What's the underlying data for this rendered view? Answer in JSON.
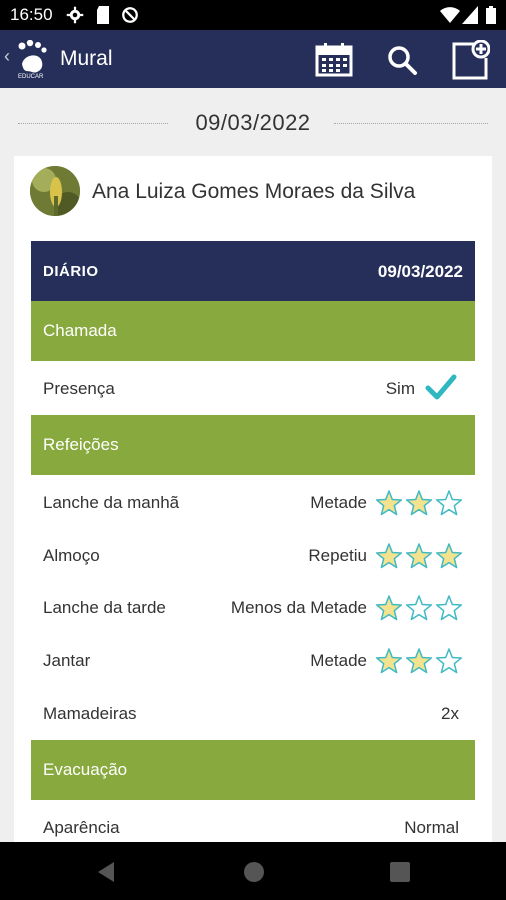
{
  "status_bar": {
    "time": "16:50"
  },
  "app_bar": {
    "title": "Mural",
    "logo_text": "EDUCAR"
  },
  "date_separator": "09/03/2022",
  "student": {
    "name": "Ana Luiza Gomes Moraes da Silva"
  },
  "diary": {
    "label": "DIÁRIO",
    "date": "09/03/2022"
  },
  "sections": {
    "chamada": "Chamada",
    "refeicoes": "Refeições",
    "evacuacao": "Evacuação"
  },
  "presence": {
    "label": "Presença",
    "value": "Sim",
    "checked": true
  },
  "meals": [
    {
      "label": "Lanche da manhã",
      "value": "Metade",
      "stars": 2
    },
    {
      "label": "Almoço",
      "value": "Repetiu",
      "stars": 3
    },
    {
      "label": "Lanche da tarde",
      "value": "Menos da Metade",
      "stars": 1
    },
    {
      "label": "Jantar",
      "value": "Metade",
      "stars": 2
    }
  ],
  "bottles": {
    "label": "Mamadeiras",
    "value": "2x"
  },
  "appearance": {
    "label": "Aparência",
    "value": "Normal"
  },
  "colors": {
    "navy": "#262f5a",
    "green": "#88a93d",
    "star_fill": "#f3e38f",
    "star_stroke": "#3fb9c4",
    "check": "#2fb8c2"
  }
}
